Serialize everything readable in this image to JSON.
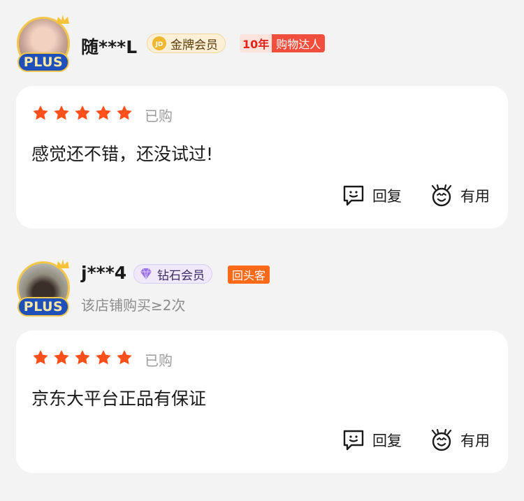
{
  "reviews": [
    {
      "username": "随***L",
      "plus_label": "PLUS",
      "member_label": "金牌会员",
      "member_icon": "jd-gold-icon",
      "badge_years": "10年",
      "badge_title": "购物达人",
      "rating": 5,
      "bought_label": "已购",
      "comment": "感觉还不错，还没试过!",
      "reply_label": "回复",
      "useful_label": "有用"
    },
    {
      "username": "j***4",
      "plus_label": "PLUS",
      "member_label": "钻石会员",
      "member_icon": "diamond-icon",
      "badge_title": "回头客",
      "repeat_text": "该店铺购买≥2次",
      "rating": 5,
      "bought_label": "已购",
      "comment": "京东大平台正品有保证",
      "reply_label": "回复",
      "useful_label": "有用"
    }
  ],
  "colors": {
    "star": "#ff4f1a",
    "plus_badge": "#1f4fb8",
    "return_badge": "#fb6a18",
    "card_bg": "#ffffff",
    "page_bg": "#f3f3f3"
  }
}
